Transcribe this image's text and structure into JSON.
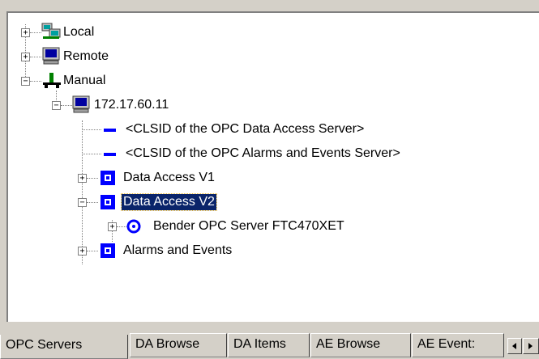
{
  "tree": {
    "local": "Local",
    "remote": "Remote",
    "manual": "Manual",
    "host": "172.17.60.11",
    "clsid_da": "<CLSID of the OPC Data Access Server>",
    "clsid_ae": "<CLSID of the OPC Alarms and Events Server>",
    "da_v1": "Data Access V1",
    "da_v2": "Data Access V2",
    "bender": "Bender OPC Server FTC470XET",
    "alarms": "Alarms and Events"
  },
  "tabs": [
    "OPC Servers",
    "DA Browse",
    "DA Items",
    "AE Browse",
    "AE Event:"
  ],
  "icons": {
    "local": "network-computer-icon",
    "remote": "monitor-icon",
    "manual": "network-connection-icon",
    "host": "monitor-icon",
    "clsid": "dash-icon",
    "server": "blue-square-icon",
    "bender": "target-icon"
  },
  "colors": {
    "selection": "#0a246a",
    "icon_blue": "#0000ff",
    "face": "#d4d0c8"
  }
}
